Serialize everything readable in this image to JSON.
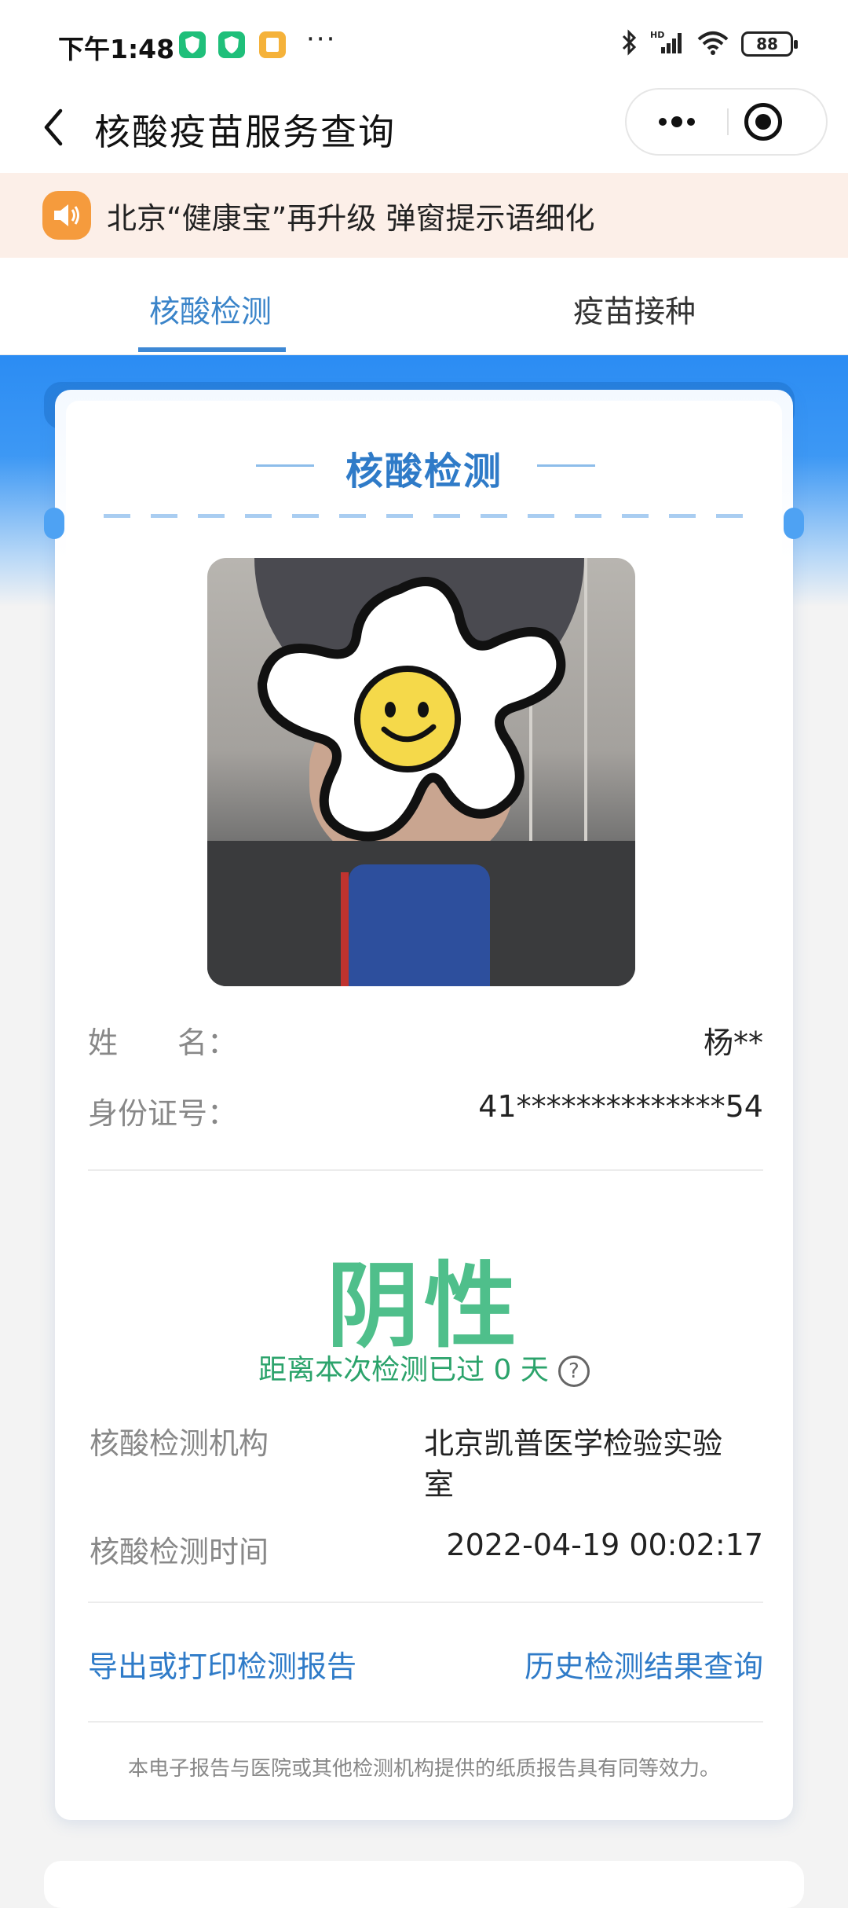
{
  "status_bar": {
    "time": "下午1:48",
    "more": "···",
    "battery": "88",
    "icons": [
      "shield-app-icon",
      "shield-app-icon",
      "note-app-icon",
      "bluetooth-icon",
      "signal-icon",
      "wifi-icon",
      "battery-icon"
    ],
    "app_icon_colors": [
      "#1fbf7a",
      "#1fbf7a",
      "#f5b23a"
    ]
  },
  "header": {
    "title": "核酸疫苗服务查询"
  },
  "notice": {
    "text": "北京“健康宝”再升级 弹窗提示语细化",
    "icon_color": "#f59b3d"
  },
  "tabs": [
    {
      "label": "核酸检测",
      "active": true
    },
    {
      "label": "疫苗接种",
      "active": false
    }
  ],
  "card": {
    "title": "核酸检测",
    "name_label": "姓　　名：",
    "name_value": "杨**",
    "id_label": "身份证号：",
    "id_value": "41**************54",
    "result": "阴性",
    "days_text": "距离本次检测已过 0 天",
    "help": "?",
    "institution_label": "核酸检测机构",
    "institution_value_line1": "北京凯普医学检验实验",
    "institution_value_line2": "室",
    "time_label": "核酸检测时间",
    "time_value": "2022-04-19 00:02:17",
    "export_link": "导出或打印检测报告",
    "history_link": "历史检测结果查询",
    "footnote": "本电子报告与医院或其他检测机构提供的纸质报告具有同等效力。"
  },
  "colors": {
    "accent_blue": "#2f7bc8",
    "negative_green": "#4fbf8b",
    "days_green": "#2ba36b"
  }
}
